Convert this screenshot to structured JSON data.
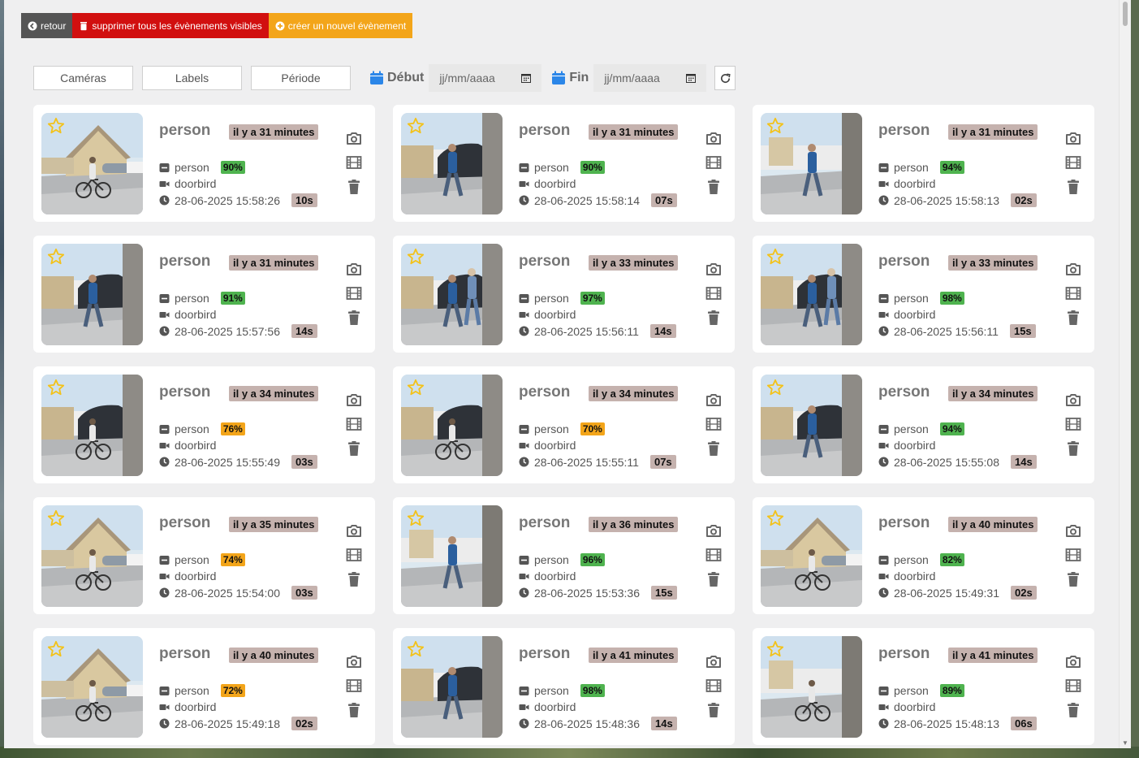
{
  "toolbar": {
    "back_label": "retour",
    "delete_all_label": "supprimer tous les évènements visibles",
    "create_label": "créer un nouvel évènement"
  },
  "filters": {
    "cameras_label": "Caméras",
    "labels_label": "Labels",
    "period_label": "Période",
    "start_label": "Début",
    "start_placeholder": "jj/mm/aaaa",
    "end_label": "Fin",
    "end_placeholder": "jj/mm/aaaa"
  },
  "colors": {
    "delete_red": "#d10f0f",
    "create_orange": "#f3a51a",
    "score_high": "#4fb34f",
    "score_mid": "#f3a51a",
    "badge_bg": "#c5b2ae",
    "calendar_blue": "#2b86e8",
    "star_yellow": "#f3c21a"
  },
  "events": [
    {
      "label": "person",
      "ago": "il y a 31 minutes",
      "sub_label": "person",
      "score": "90%",
      "level": "hi",
      "camera": "doorbird",
      "datetime": "28-06-2025 15:58:26",
      "duration": "10s",
      "scene": "house-bike"
    },
    {
      "label": "person",
      "ago": "il y a 31 minutes",
      "sub_label": "person",
      "score": "90%",
      "level": "hi",
      "camera": "doorbird",
      "datetime": "28-06-2025 15:58:14",
      "duration": "07s",
      "scene": "car-walk"
    },
    {
      "label": "person",
      "ago": "il y a 31 minutes",
      "sub_label": "person",
      "score": "94%",
      "level": "hi",
      "camera": "doorbird",
      "datetime": "28-06-2025 15:58:13",
      "duration": "02s",
      "scene": "road-walk"
    },
    {
      "label": "person",
      "ago": "il y a 31 minutes",
      "sub_label": "person",
      "score": "91%",
      "level": "hi",
      "camera": "doorbird",
      "datetime": "28-06-2025 15:57:56",
      "duration": "14s",
      "scene": "car-walk"
    },
    {
      "label": "person",
      "ago": "il y a 33 minutes",
      "sub_label": "person",
      "score": "97%",
      "level": "hi",
      "camera": "doorbird",
      "datetime": "28-06-2025 15:56:11",
      "duration": "14s",
      "scene": "two-walk"
    },
    {
      "label": "person",
      "ago": "il y a 33 minutes",
      "sub_label": "person",
      "score": "98%",
      "level": "hi",
      "camera": "doorbird",
      "datetime": "28-06-2025 15:56:11",
      "duration": "15s",
      "scene": "two-walk"
    },
    {
      "label": "person",
      "ago": "il y a 34 minutes",
      "sub_label": "person",
      "score": "76%",
      "level": "mid",
      "camera": "doorbird",
      "datetime": "28-06-2025 15:55:49",
      "duration": "03s",
      "scene": "car-bike"
    },
    {
      "label": "person",
      "ago": "il y a 34 minutes",
      "sub_label": "person",
      "score": "70%",
      "level": "mid",
      "camera": "doorbird",
      "datetime": "28-06-2025 15:55:11",
      "duration": "07s",
      "scene": "car-bike"
    },
    {
      "label": "person",
      "ago": "il y a 34 minutes",
      "sub_label": "person",
      "score": "94%",
      "level": "hi",
      "camera": "doorbird",
      "datetime": "28-06-2025 15:55:08",
      "duration": "14s",
      "scene": "car-walk"
    },
    {
      "label": "person",
      "ago": "il y a 35 minutes",
      "sub_label": "person",
      "score": "74%",
      "level": "mid",
      "camera": "doorbird",
      "datetime": "28-06-2025 15:54:00",
      "duration": "03s",
      "scene": "house-bike"
    },
    {
      "label": "person",
      "ago": "il y a 36 minutes",
      "sub_label": "person",
      "score": "96%",
      "level": "hi",
      "camera": "doorbird",
      "datetime": "28-06-2025 15:53:36",
      "duration": "15s",
      "scene": "road-walk"
    },
    {
      "label": "person",
      "ago": "il y a 40 minutes",
      "sub_label": "person",
      "score": "82%",
      "level": "hi",
      "camera": "doorbird",
      "datetime": "28-06-2025 15:49:31",
      "duration": "02s",
      "scene": "house-bike"
    },
    {
      "label": "person",
      "ago": "il y a 40 minutes",
      "sub_label": "person",
      "score": "72%",
      "level": "mid",
      "camera": "doorbird",
      "datetime": "28-06-2025 15:49:18",
      "duration": "02s",
      "scene": "house-bike"
    },
    {
      "label": "person",
      "ago": "il y a 41 minutes",
      "sub_label": "person",
      "score": "98%",
      "level": "hi",
      "camera": "doorbird",
      "datetime": "28-06-2025 15:48:36",
      "duration": "14s",
      "scene": "car-walk"
    },
    {
      "label": "person",
      "ago": "il y a 41 minutes",
      "sub_label": "person",
      "score": "89%",
      "level": "hi",
      "camera": "doorbird",
      "datetime": "28-06-2025 15:48:13",
      "duration": "06s",
      "scene": "road-bike"
    }
  ]
}
